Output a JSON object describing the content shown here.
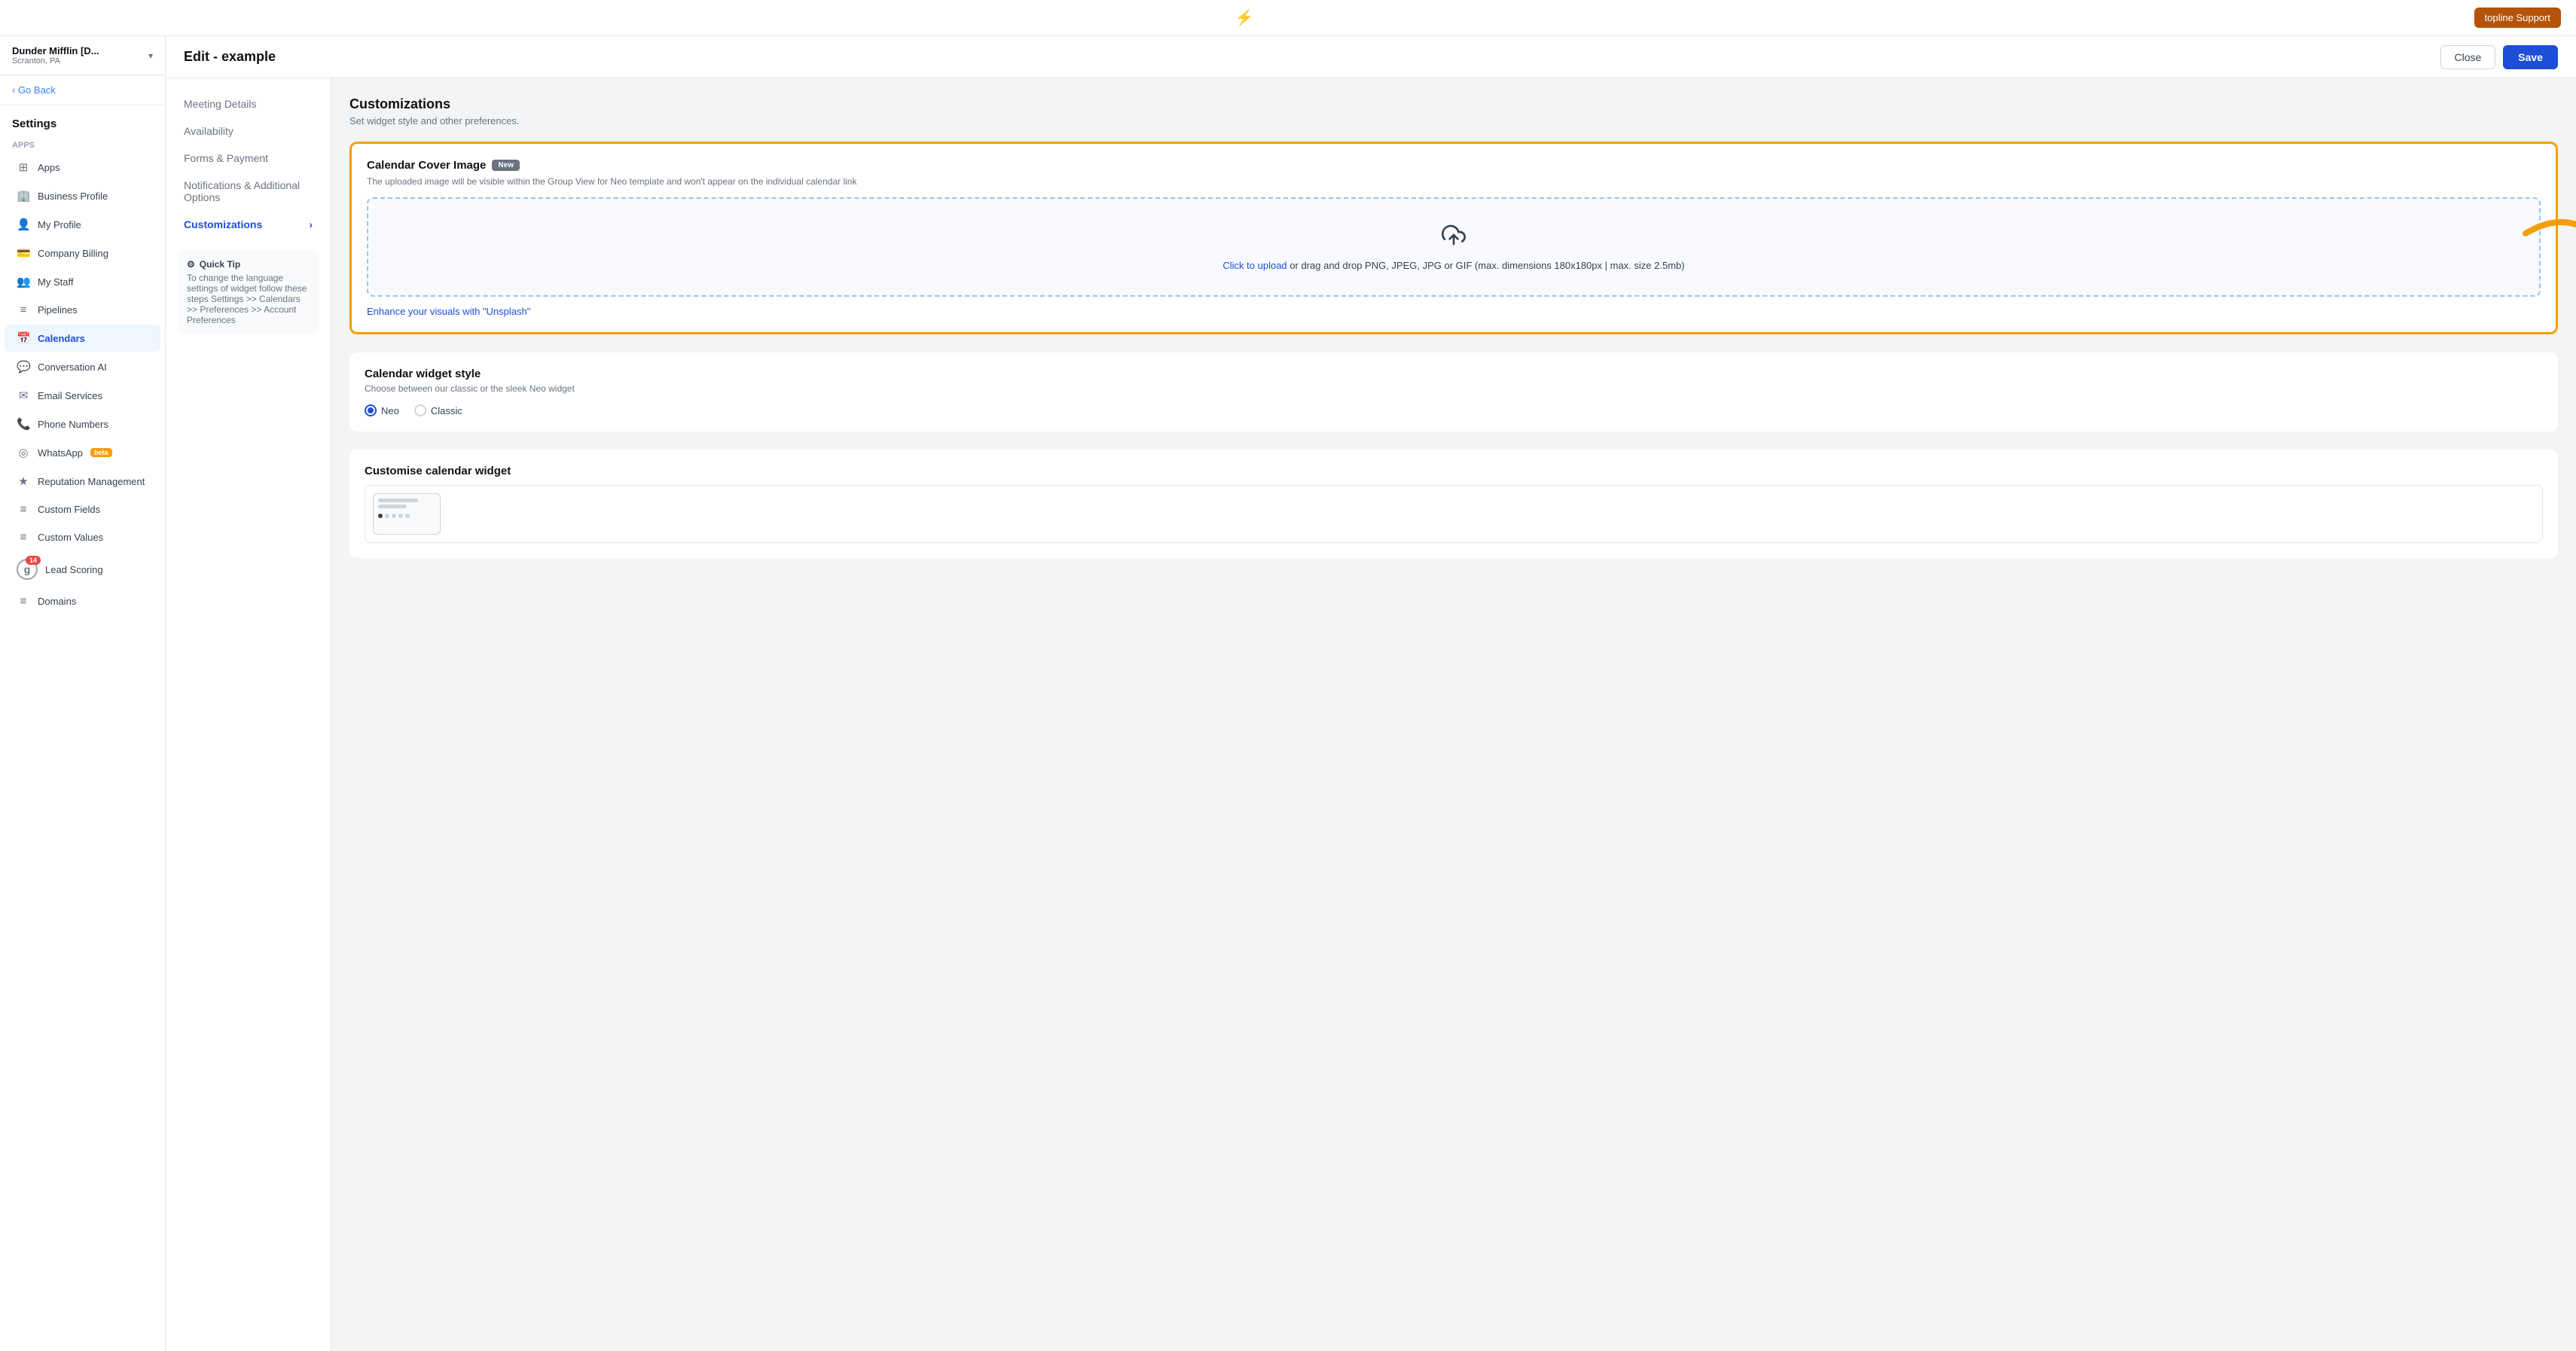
{
  "topbar": {
    "lightning_icon": "⚡",
    "support_btn_label": "topline Support"
  },
  "sidebar": {
    "workspace_name": "Dunder Mifflin [D...",
    "workspace_sub": "Scranton, PA",
    "go_back_label": "‹ Go Back",
    "settings_title": "Settings",
    "group_apps": "Apps",
    "items": [
      {
        "id": "apps",
        "label": "Apps",
        "icon": "⚙"
      },
      {
        "id": "business-profile",
        "label": "Business Profile",
        "icon": "🏢"
      },
      {
        "id": "my-profile",
        "label": "My Profile",
        "icon": "👤"
      },
      {
        "id": "company-billing",
        "label": "Company Billing",
        "icon": "💳"
      },
      {
        "id": "my-staff",
        "label": "My Staff",
        "icon": "👥"
      },
      {
        "id": "pipelines",
        "label": "Pipelines",
        "icon": "≡"
      },
      {
        "id": "calendars",
        "label": "Calendars",
        "icon": "📅",
        "active": true
      },
      {
        "id": "conversation-ai",
        "label": "Conversation AI",
        "icon": "💬"
      },
      {
        "id": "email-services",
        "label": "Email Services",
        "icon": "✉"
      },
      {
        "id": "phone-numbers",
        "label": "Phone Numbers",
        "icon": "📞"
      },
      {
        "id": "whatsapp",
        "label": "WhatsApp",
        "icon": "◎",
        "badge": "beta"
      },
      {
        "id": "reputation-management",
        "label": "Reputation Management",
        "icon": "★"
      },
      {
        "id": "custom-fields",
        "label": "Custom Fields",
        "icon": "≡"
      },
      {
        "id": "custom-values",
        "label": "Custom Values",
        "icon": "≡"
      },
      {
        "id": "lead-scoring",
        "label": "Lead Scoring",
        "icon": "g",
        "notif": "14"
      },
      {
        "id": "domains",
        "label": "Domains",
        "icon": "≡"
      }
    ]
  },
  "edit_header": {
    "title": "Edit - example",
    "close_label": "Close",
    "save_label": "Save"
  },
  "left_nav": {
    "items": [
      {
        "id": "meeting-details",
        "label": "Meeting Details",
        "active": false
      },
      {
        "id": "availability",
        "label": "Availability",
        "active": false
      },
      {
        "id": "forms-payment",
        "label": "Forms & Payment",
        "active": false
      },
      {
        "id": "notifications",
        "label": "Notifications & Additional Options",
        "active": false
      },
      {
        "id": "customizations",
        "label": "Customizations",
        "active": true
      }
    ],
    "quick_tip_title": "Quick Tip",
    "quick_tip_icon": "⚙",
    "quick_tip_text": "To change the language settings of widget follow these steps Settings >> Calendars >> Preferences >> Account Preferences"
  },
  "main": {
    "section_title": "Customizations",
    "section_sub": "Set widget style and other preferences.",
    "cover_image": {
      "title": "Calendar Cover Image",
      "badge": "New",
      "description": "The uploaded image will be visible within the Group View for Neo template and won't appear on the individual calendar link",
      "upload_icon": "⬆",
      "upload_text_link": "Click to upload",
      "upload_text_rest": " or drag and drop PNG, JPEG, JPG or GIF (max. dimensions 180x180px | max. size 2.5mb)",
      "unsplash_link": "Enhance your visuals with \"Unsplash\""
    },
    "widget_style": {
      "title": "Calendar widget style",
      "sub": "Choose between our classic or the sleek Neo widget",
      "options": [
        {
          "id": "neo",
          "label": "Neo",
          "selected": true
        },
        {
          "id": "classic",
          "label": "Classic",
          "selected": false
        }
      ]
    },
    "customise_widget": {
      "title": "Customise calendar widget"
    }
  },
  "colors": {
    "accent_blue": "#1d4ed8",
    "accent_yellow": "#f59e0b",
    "accent_red": "#ef4444"
  }
}
